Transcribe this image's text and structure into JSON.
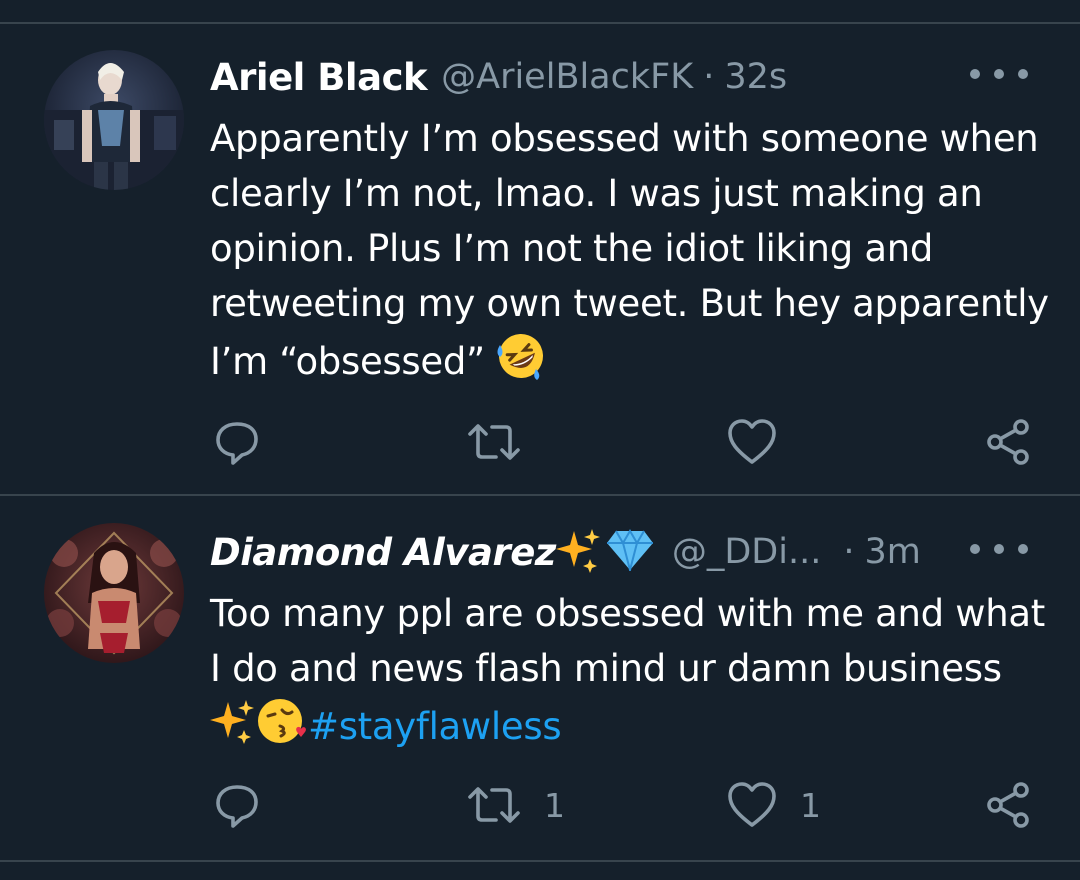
{
  "tweets": [
    {
      "name": "Ariel Black",
      "handle": "@ArielBlackFK",
      "separator": "·",
      "time": "32s",
      "text": "Apparently I’m obsessed with someone when clearly I’m not, lmao. I was just making an opinion. Plus I’m not the idiot liking and retweeting my own tweet. But hey apparently I’m “obsessed”",
      "emoji_icons": [
        "rolling-on-floor-laughing-emoji"
      ],
      "retweet_count": "",
      "like_count": ""
    },
    {
      "name": "Diamond Alvarez",
      "name_emoji_icons": [
        "sparkles-emoji",
        "gem-emoji"
      ],
      "handle": "@_DDi...",
      "separator": "·",
      "time": "3m",
      "text": "Too many ppl are obsessed with me and what I do and news flash mind ur damn business",
      "emoji_icons": [
        "sparkles-emoji",
        "kissing-heart-emoji"
      ],
      "hashtag": "#stayflawless",
      "retweet_count": "1",
      "like_count": "1"
    }
  ],
  "colors": {
    "background": "#15202b",
    "text": "#ffffff",
    "secondary": "#8899a6",
    "divider": "#38444d",
    "link": "#1da1f2"
  }
}
